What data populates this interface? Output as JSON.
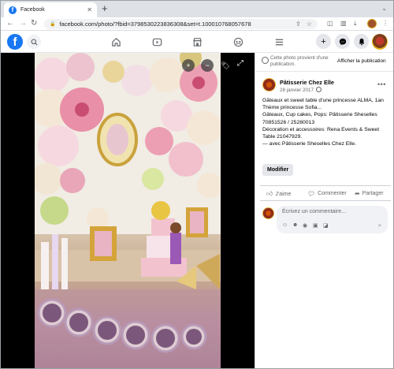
{
  "browser": {
    "tab_title": "Facebook",
    "tab_close": "✕",
    "new_tab": "+",
    "url": "facebook.com/photo/?fbid=3798530223836308&set=t.100010768057678"
  },
  "fb": {
    "logo": "f"
  },
  "viewer": {
    "zoom_in": "+",
    "zoom_out": "−"
  },
  "panel": {
    "notice_text": "Cette photo provient d'une publication.",
    "notice_link": "Afficher la publication",
    "author": "Pâtisserie Chez Elle",
    "date": "28 janvier 2017",
    "more": "•••",
    "caption_lines": [
      "Gâteaux et sweet table d'une princesse ALMA, 1an",
      "Thème princesse Sofia...",
      "Gâteaux, Cup cakes, Pops: Pâtisserie Sheselles 70851526 / 25280013",
      "Décoration et accessoires: Rena Events & Sweet Table 21047929.",
      "— avec Pâtisserie Sheselles Chez Elle."
    ],
    "edit_button": "Modifier",
    "like": "J'aime",
    "comment": "Commenter",
    "share": "Partager",
    "comment_placeholder": "Écrivez un commentaire..."
  },
  "colors": {
    "fb_blue": "#1877f2",
    "viewer_bg": "#000000",
    "chip_bg": "#e4e6eb"
  }
}
